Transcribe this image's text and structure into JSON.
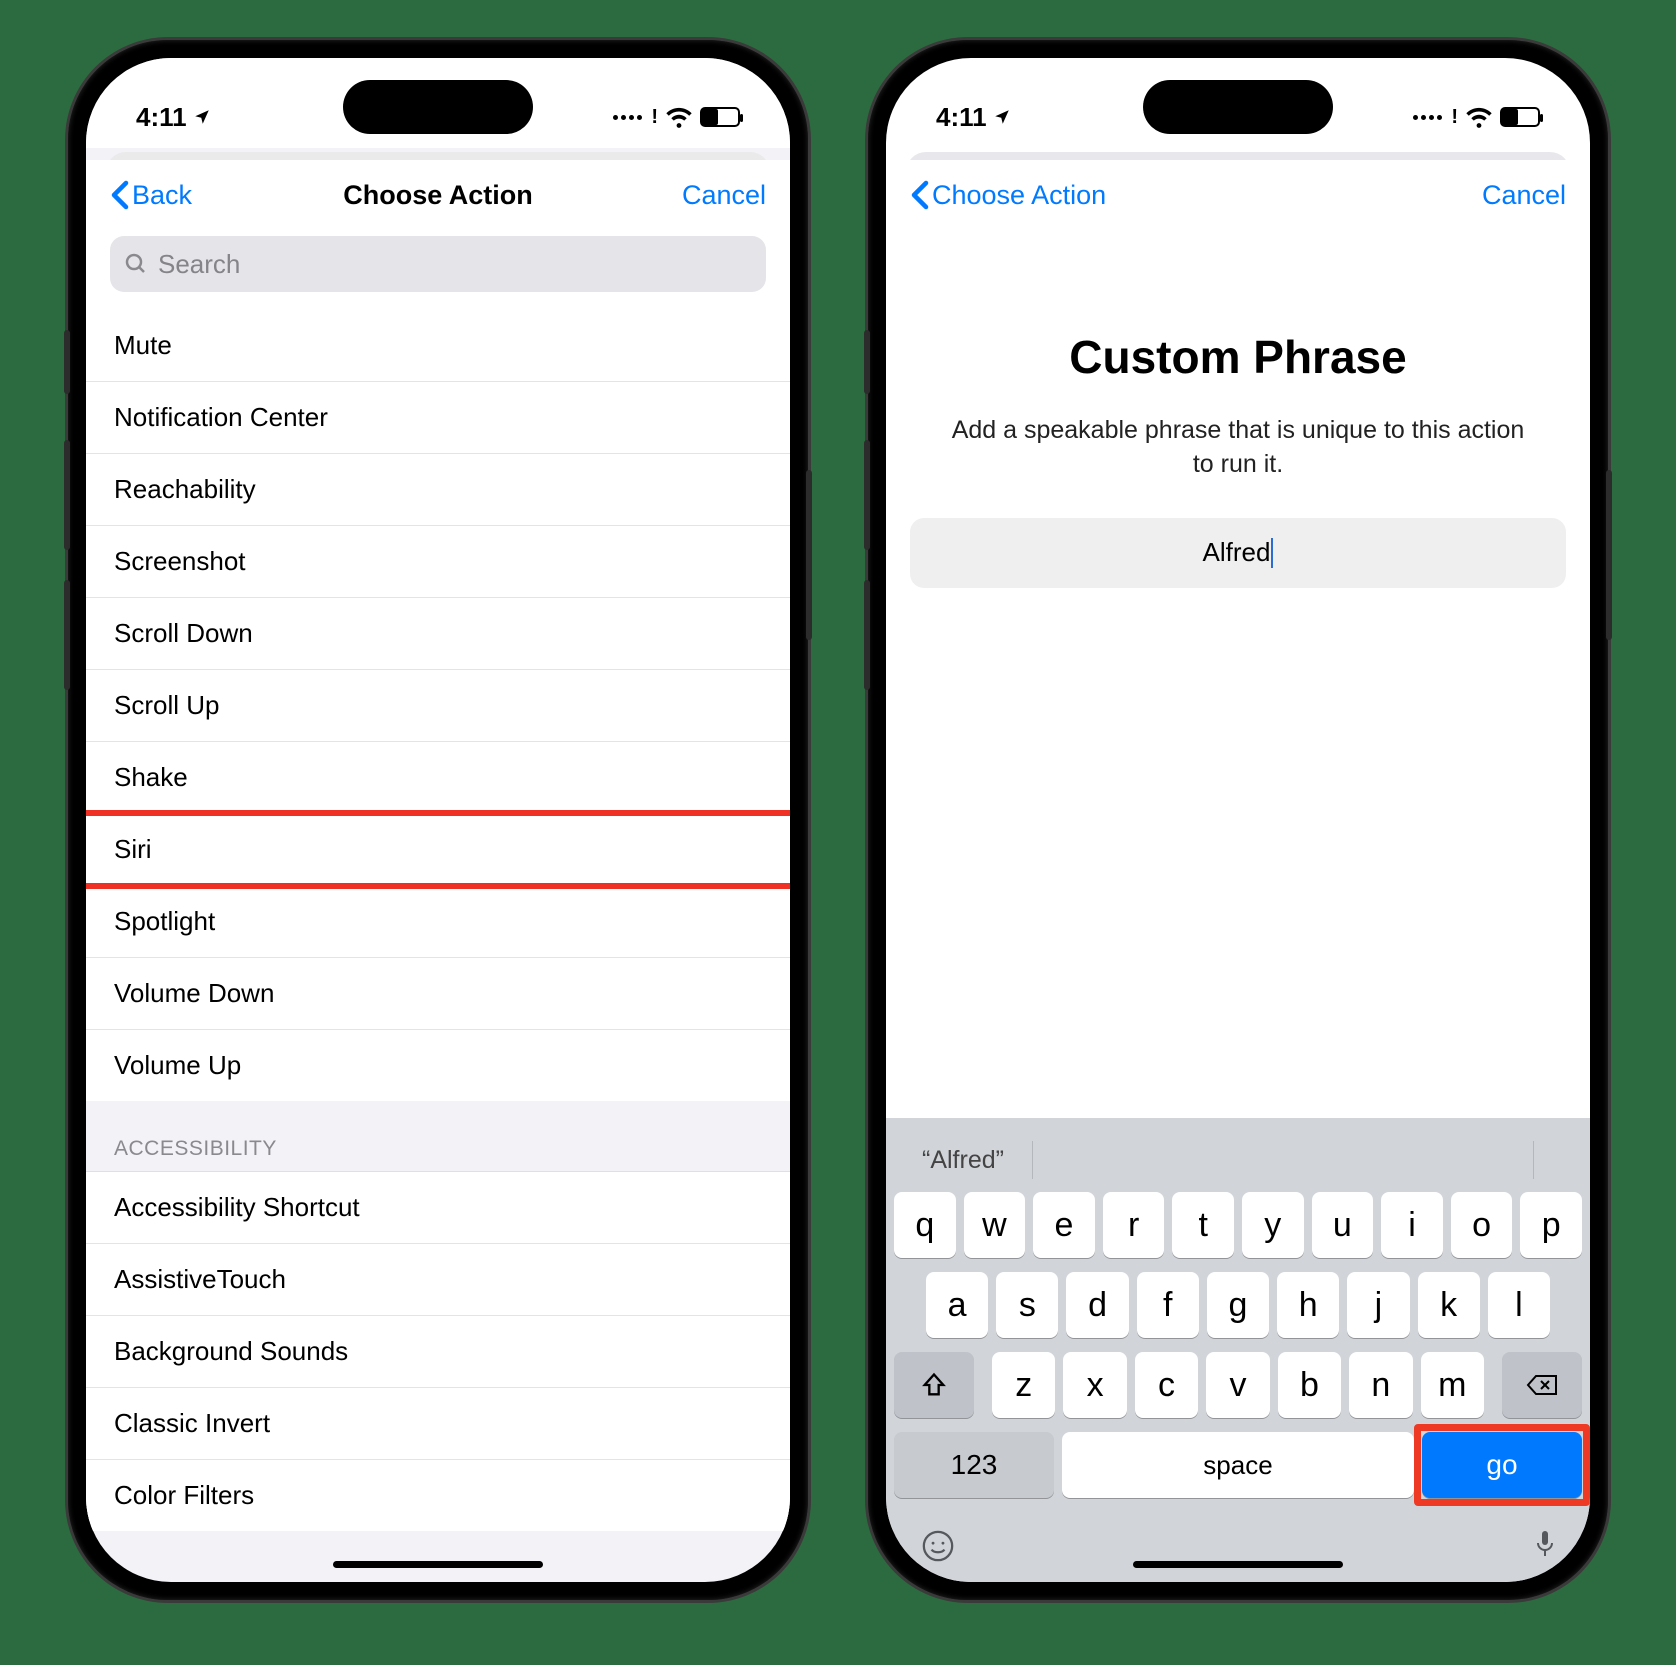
{
  "status": {
    "time": "4:11",
    "signal_bang": "!"
  },
  "left": {
    "nav": {
      "back": "Back",
      "title": "Choose Action",
      "cancel": "Cancel"
    },
    "search_placeholder": "Search",
    "system_rows": [
      "Mute",
      "Notification Center",
      "Reachability",
      "Screenshot",
      "Scroll Down",
      "Scroll Up",
      "Shake",
      "Siri",
      "Spotlight",
      "Volume Down",
      "Volume Up"
    ],
    "highlight_index": 7,
    "accessibility_header": "ACCESSIBILITY",
    "accessibility_rows": [
      "Accessibility Shortcut",
      "AssistiveTouch",
      "Background Sounds",
      "Classic Invert",
      "Color Filters"
    ]
  },
  "right": {
    "nav": {
      "back": "Choose Action",
      "cancel": "Cancel"
    },
    "title": "Custom Phrase",
    "subtitle": "Add a speakable phrase that is unique to this action to run it.",
    "input_value": "Alfred",
    "prediction": "“Alfred”",
    "krow1": [
      "q",
      "w",
      "e",
      "r",
      "t",
      "y",
      "u",
      "i",
      "o",
      "p"
    ],
    "krow2": [
      "a",
      "s",
      "d",
      "f",
      "g",
      "h",
      "j",
      "k",
      "l"
    ],
    "krow3": [
      "z",
      "x",
      "c",
      "v",
      "b",
      "n",
      "m"
    ],
    "key_123": "123",
    "key_space": "space",
    "key_go": "go"
  }
}
